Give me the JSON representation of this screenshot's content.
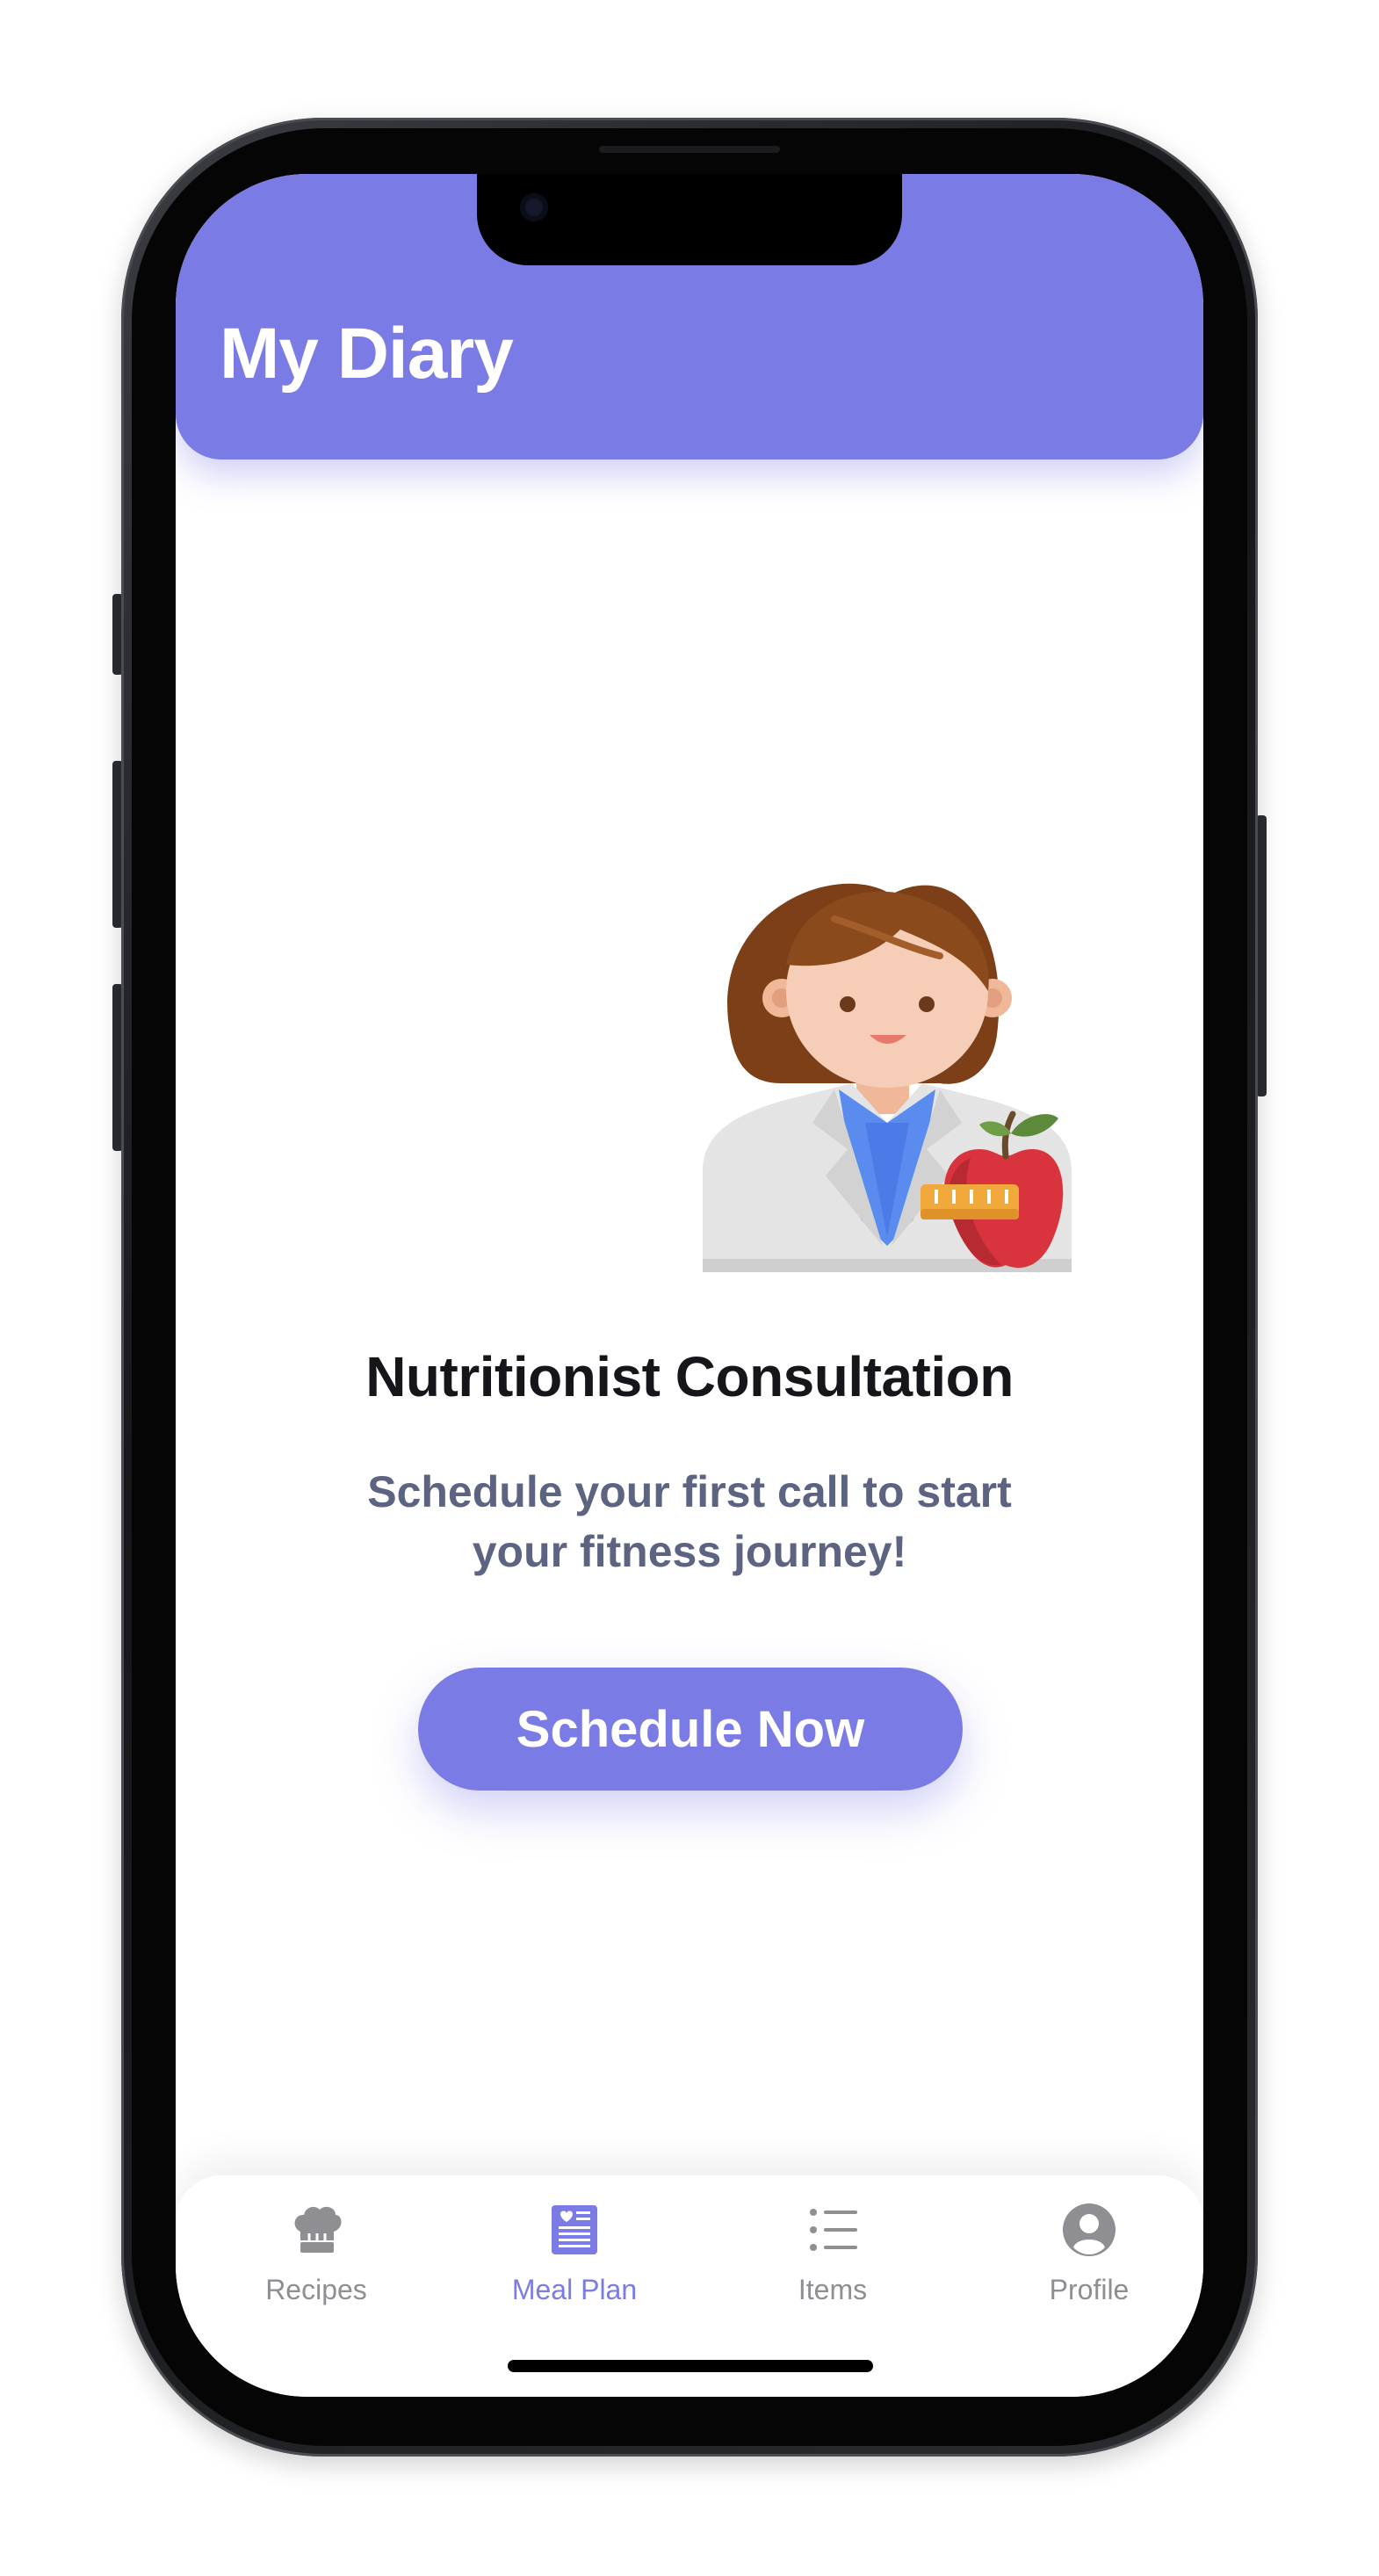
{
  "header": {
    "title": "My Diary"
  },
  "empty_state": {
    "title": "Nutritionist Consultation",
    "subtitle": "Schedule your first call to start your fitness journey!",
    "button_label": "Schedule Now",
    "illustration": "nutritionist-with-apple"
  },
  "tabbar": {
    "items": [
      {
        "label": "Recipes",
        "icon": "chef-hat-icon",
        "active": false
      },
      {
        "label": "Meal Plan",
        "icon": "meal-plan-icon",
        "active": true
      },
      {
        "label": "Items",
        "icon": "list-icon",
        "active": false
      },
      {
        "label": "Profile",
        "icon": "profile-icon",
        "active": false
      }
    ]
  },
  "colors": {
    "accent": "#7b7be6",
    "title_text": "#15151a",
    "subtitle_text": "#5d6482",
    "inactive_tab": "#8e8e93"
  }
}
